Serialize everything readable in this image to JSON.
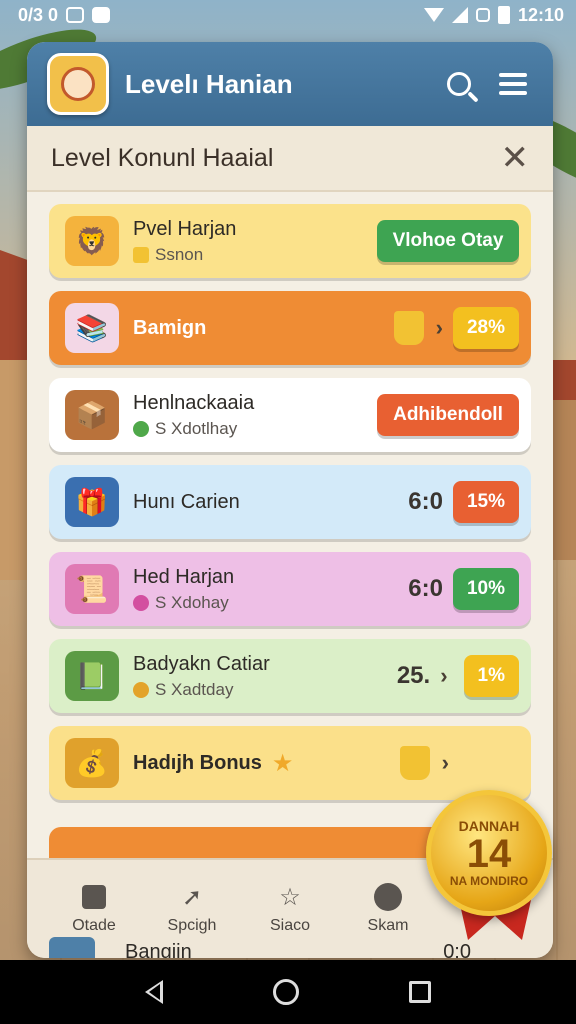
{
  "status_bar": {
    "left_text": "0/3 0",
    "time": "12:10"
  },
  "header": {
    "app_title": "Levelı Hanian"
  },
  "dialog": {
    "title": "Level Konunl Haaial"
  },
  "rows": [
    {
      "title": "Pvel Harjan",
      "subtitle": "Ssnon",
      "action": "Vlohoe Otay",
      "color": "#fbe28b"
    },
    {
      "title": "Bamign",
      "badge": "28%"
    },
    {
      "title": "Henlnackaaia",
      "subtitle": "S Xdotlhay",
      "action": "Adhibendoll"
    },
    {
      "title": "Hunı Carien",
      "value": "6:0",
      "badge": "15%"
    },
    {
      "title": "Hed Harjan",
      "subtitle": "S Xdohay",
      "value": "6:0",
      "badge": "10%"
    },
    {
      "title": "Badyakn Catiar",
      "subtitle": "S Xadtday",
      "value": "25.",
      "badge": "1%"
    },
    {
      "title": "Hadıjh Bonus"
    }
  ],
  "peek_row": {
    "title": "Bangiin",
    "value": "0:0"
  },
  "bottom_nav": [
    {
      "label": "Otade",
      "icon": "box-icon"
    },
    {
      "label": "Spcigh",
      "icon": "arrow-icon"
    },
    {
      "label": "Siaco",
      "icon": "star-icon"
    },
    {
      "label": "Skam",
      "icon": "person-icon"
    }
  ],
  "medal": {
    "top": "DANNAH",
    "number": "14",
    "bottom": "NA MONDIRO"
  },
  "colors": {
    "header": "#4e80a8",
    "green_action": "#3ea452",
    "red_action": "#e86032",
    "yellow_badge": "#f3c01f"
  }
}
